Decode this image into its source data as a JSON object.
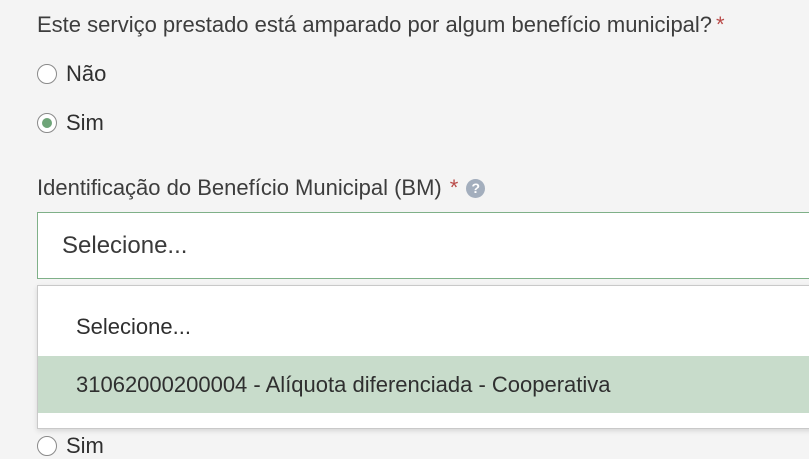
{
  "form": {
    "question": "Este serviço prestado está amparado por algum benefício municipal?",
    "required_mark": "*",
    "options": [
      {
        "label": "Não",
        "checked": false
      },
      {
        "label": "Sim",
        "checked": true
      }
    ],
    "bm_label": "Identificação do Benefício Municipal (BM)",
    "bm_required_mark": "*",
    "help_icon": "question-circle-icon",
    "select": {
      "value": "Selecione...",
      "dropdown_open": true,
      "options": [
        {
          "label": "Selecione...",
          "highlighted": false
        },
        {
          "label": "31062000200004 - Alíquota diferenciada - Cooperativa",
          "highlighted": true
        }
      ]
    },
    "partial_below": {
      "label": "Sim"
    }
  },
  "colors": {
    "background": "#f4f4f4",
    "required": "#b94a48",
    "radio_checked": "#6ea478",
    "focus_border": "#7fb088",
    "highlight": "#c8dccb",
    "help_icon": "#a3aebd"
  }
}
